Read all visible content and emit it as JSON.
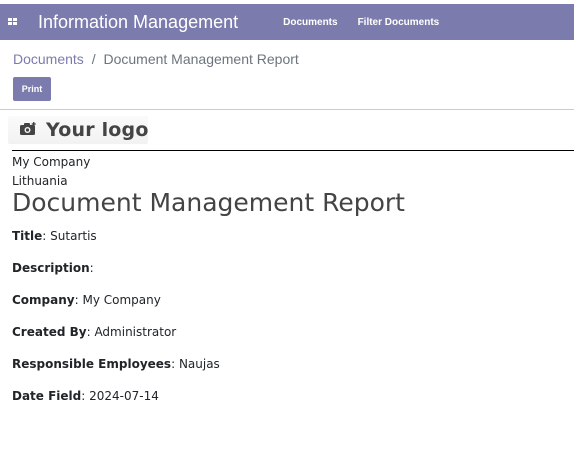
{
  "navbar": {
    "app_title": "Information Management",
    "menu": [
      {
        "label": "Documents"
      },
      {
        "label": "Filter Documents"
      }
    ],
    "color": "#7c7bad",
    "apps_icon": "grid-icon"
  },
  "breadcrumb": {
    "parent": "Documents",
    "separator": "/",
    "current": "Document Management Report"
  },
  "toolbar": {
    "print_label": "Print"
  },
  "report": {
    "logo_text": "Your logo",
    "logo_icon": "camera-icon",
    "company_name": "My Company",
    "company_country": "Lithuania",
    "title": "Document Management Report",
    "fields": [
      {
        "label": "Title",
        "value": "Sutartis"
      },
      {
        "label": "Description",
        "value": ""
      },
      {
        "label": "Company",
        "value": "My Company"
      },
      {
        "label": "Created By",
        "value": "Administrator"
      },
      {
        "label": "Responsible Employees",
        "value": "Naujas"
      },
      {
        "label": "Date Field",
        "value": "2024-07-14"
      }
    ]
  }
}
